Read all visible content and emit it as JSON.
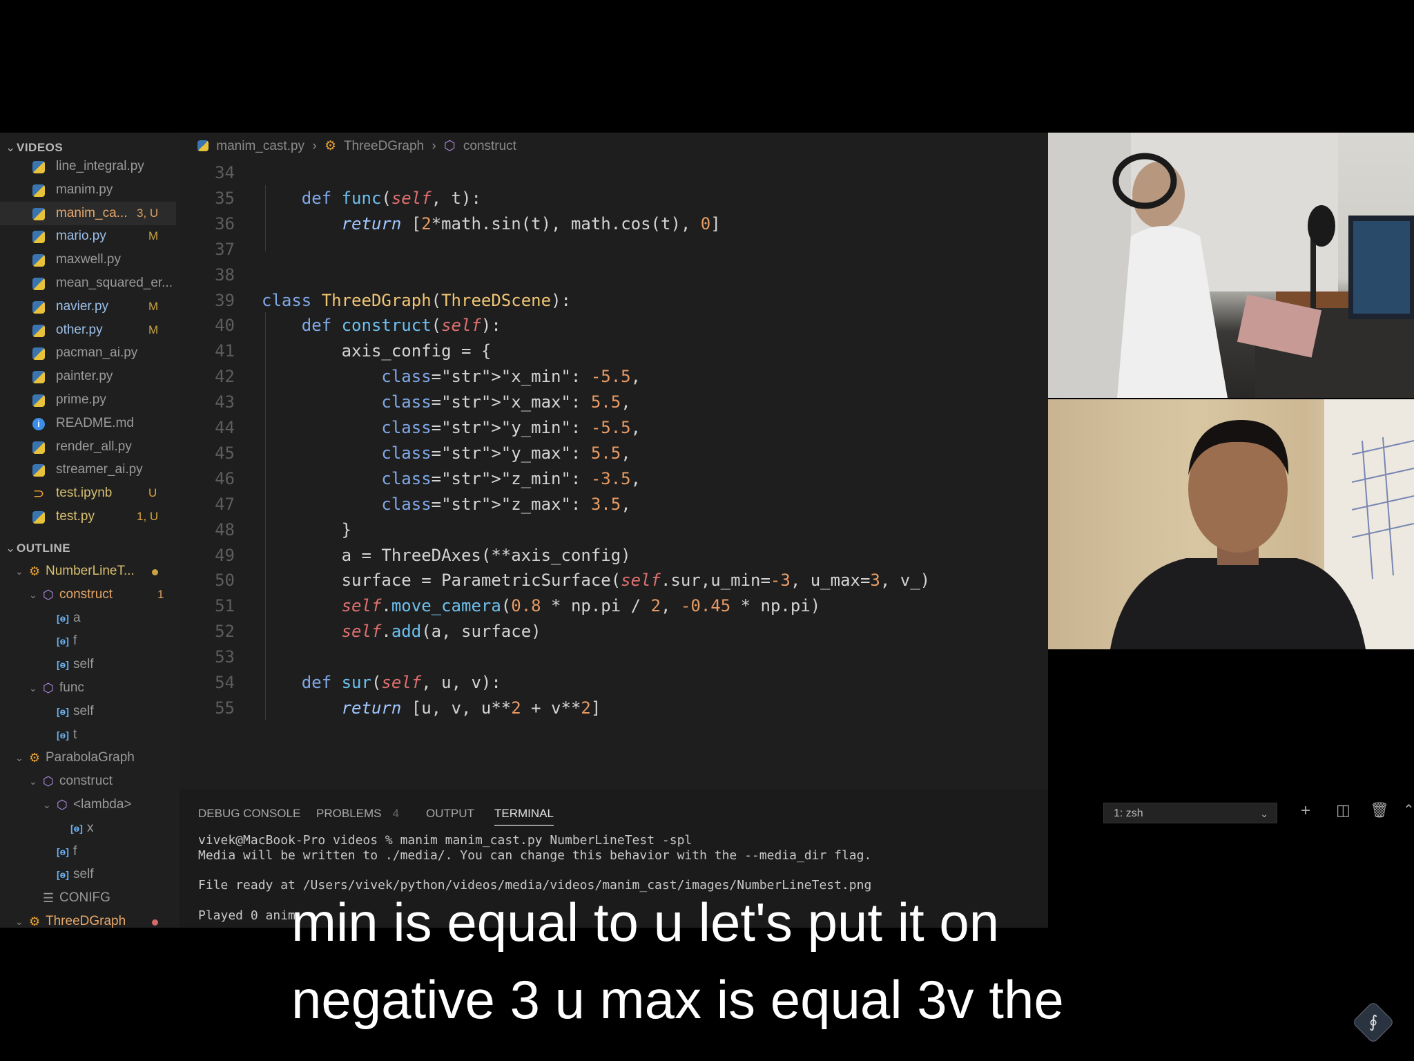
{
  "explorer": {
    "header": "VIDEOS",
    "files": [
      {
        "name": "line_integral.py",
        "badge": "",
        "icon": "python-icon",
        "status": ""
      },
      {
        "name": "manim.py",
        "badge": "",
        "icon": "python-icon",
        "status": ""
      },
      {
        "name": "manim_ca...",
        "badge": "3, U",
        "icon": "python-icon",
        "status": "error"
      },
      {
        "name": "mario.py",
        "badge": "M",
        "icon": "python-icon",
        "status": "modified"
      },
      {
        "name": "maxwell.py",
        "badge": "",
        "icon": "python-icon",
        "status": ""
      },
      {
        "name": "mean_squared_er...",
        "badge": "",
        "icon": "python-icon",
        "status": ""
      },
      {
        "name": "navier.py",
        "badge": "M",
        "icon": "python-icon",
        "status": "modified"
      },
      {
        "name": "other.py",
        "badge": "M",
        "icon": "python-icon",
        "status": "modified"
      },
      {
        "name": "pacman_ai.py",
        "badge": "",
        "icon": "python-icon",
        "status": ""
      },
      {
        "name": "painter.py",
        "badge": "",
        "icon": "python-icon",
        "status": ""
      },
      {
        "name": "prime.py",
        "badge": "",
        "icon": "python-icon",
        "status": ""
      },
      {
        "name": "README.md",
        "badge": "",
        "icon": "info-icon",
        "status": ""
      },
      {
        "name": "render_all.py",
        "badge": "",
        "icon": "python-icon",
        "status": ""
      },
      {
        "name": "streamer_ai.py",
        "badge": "",
        "icon": "python-icon",
        "status": ""
      },
      {
        "name": "test.ipynb",
        "badge": "U",
        "icon": "notebook-icon",
        "status": "untracked"
      },
      {
        "name": "test.py",
        "badge": "1, U",
        "icon": "python-icon",
        "status": "untracked"
      }
    ]
  },
  "outline": {
    "header": "OUTLINE",
    "items": [
      {
        "label": "NumberLineT...",
        "kind": "class",
        "marker": "modified-dot",
        "badge": ""
      },
      {
        "label": "construct",
        "kind": "method",
        "marker": "",
        "badge": "1"
      },
      {
        "label": "a",
        "kind": "variable",
        "marker": "",
        "badge": ""
      },
      {
        "label": "f",
        "kind": "variable",
        "marker": "",
        "badge": ""
      },
      {
        "label": "self",
        "kind": "variable",
        "marker": "",
        "badge": ""
      },
      {
        "label": "func",
        "kind": "method",
        "marker": "",
        "badge": ""
      },
      {
        "label": "self",
        "kind": "variable",
        "marker": "",
        "badge": ""
      },
      {
        "label": "t",
        "kind": "variable",
        "marker": "",
        "badge": ""
      },
      {
        "label": "ParabolaGraph",
        "kind": "class",
        "marker": "",
        "badge": ""
      },
      {
        "label": "construct",
        "kind": "method",
        "marker": "",
        "badge": ""
      },
      {
        "label": "<lambda>",
        "kind": "method",
        "marker": "",
        "badge": ""
      },
      {
        "label": "x",
        "kind": "variable",
        "marker": "",
        "badge": ""
      },
      {
        "label": "f",
        "kind": "variable",
        "marker": "",
        "badge": ""
      },
      {
        "label": "self",
        "kind": "variable",
        "marker": "",
        "badge": ""
      },
      {
        "label": "CONIFG",
        "kind": "constant",
        "marker": "",
        "badge": ""
      },
      {
        "label": "ThreeDGraph",
        "kind": "class",
        "marker": "error-dot",
        "badge": ""
      }
    ]
  },
  "breadcrumb": {
    "file": "manim_cast.py",
    "class": "ThreeDGraph",
    "method": "construct"
  },
  "code": {
    "lines": [
      {
        "n": "34",
        "text": ""
      },
      {
        "n": "35",
        "text": "    def func(self, t):"
      },
      {
        "n": "36",
        "text": "        return [2*math.sin(t), math.cos(t), 0]"
      },
      {
        "n": "37",
        "text": ""
      },
      {
        "n": "38",
        "text": ""
      },
      {
        "n": "39",
        "text": "class ThreeDGraph(ThreeDScene):"
      },
      {
        "n": "40",
        "text": "    def construct(self):"
      },
      {
        "n": "41",
        "text": "        axis_config = {"
      },
      {
        "n": "42",
        "text": "            \"x_min\": -5.5,"
      },
      {
        "n": "43",
        "text": "            \"x_max\": 5.5,"
      },
      {
        "n": "44",
        "text": "            \"y_min\": -5.5,"
      },
      {
        "n": "45",
        "text": "            \"y_max\": 5.5,"
      },
      {
        "n": "46",
        "text": "            \"z_min\": -3.5,"
      },
      {
        "n": "47",
        "text": "            \"z_max\": 3.5,"
      },
      {
        "n": "48",
        "text": "        }"
      },
      {
        "n": "49",
        "text": "        a = ThreeDAxes(**axis_config)"
      },
      {
        "n": "50",
        "text": "        surface = ParametricSurface(self.sur,u_min=-3, u_max=3, v_)"
      },
      {
        "n": "51",
        "text": "        self.move_camera(0.8 * np.pi / 2, -0.45 * np.pi)"
      },
      {
        "n": "52",
        "text": "        self.add(a, surface)"
      },
      {
        "n": "53",
        "text": ""
      },
      {
        "n": "54",
        "text": "    def sur(self, u, v):"
      },
      {
        "n": "55",
        "text": "        return [u, v, u**2 + v**2]"
      }
    ]
  },
  "panel": {
    "tabs": [
      {
        "label": "DEBUG CONSOLE",
        "count": ""
      },
      {
        "label": "PROBLEMS",
        "count": "4"
      },
      {
        "label": "OUTPUT",
        "count": ""
      },
      {
        "label": "TERMINAL",
        "count": ""
      }
    ],
    "active_tab": "TERMINAL",
    "terminal_select": "1: zsh",
    "terminal_lines": [
      "vivek@MacBook-Pro videos % manim manim_cast.py NumberLineTest -spl",
      "Media will be written to ./media/. You can change this behavior with the --media_dir flag.",
      "",
      "File ready at /Users/vivek/python/videos/media/videos/manim_cast/images/NumberLineTest.png",
      "",
      "Played 0 anim"
    ]
  },
  "subtitles": {
    "line1": "min is equal to u let's put it on",
    "line2": "negative 3 u max is equal 3v the"
  },
  "watermark": "∮",
  "colors": {
    "editor_bg": "#1e1e1e",
    "sidebar_bg": "#1f1f1f",
    "panel_bg": "#1b1b1b",
    "modified": "#c9a441",
    "error": "#e06c6c"
  }
}
